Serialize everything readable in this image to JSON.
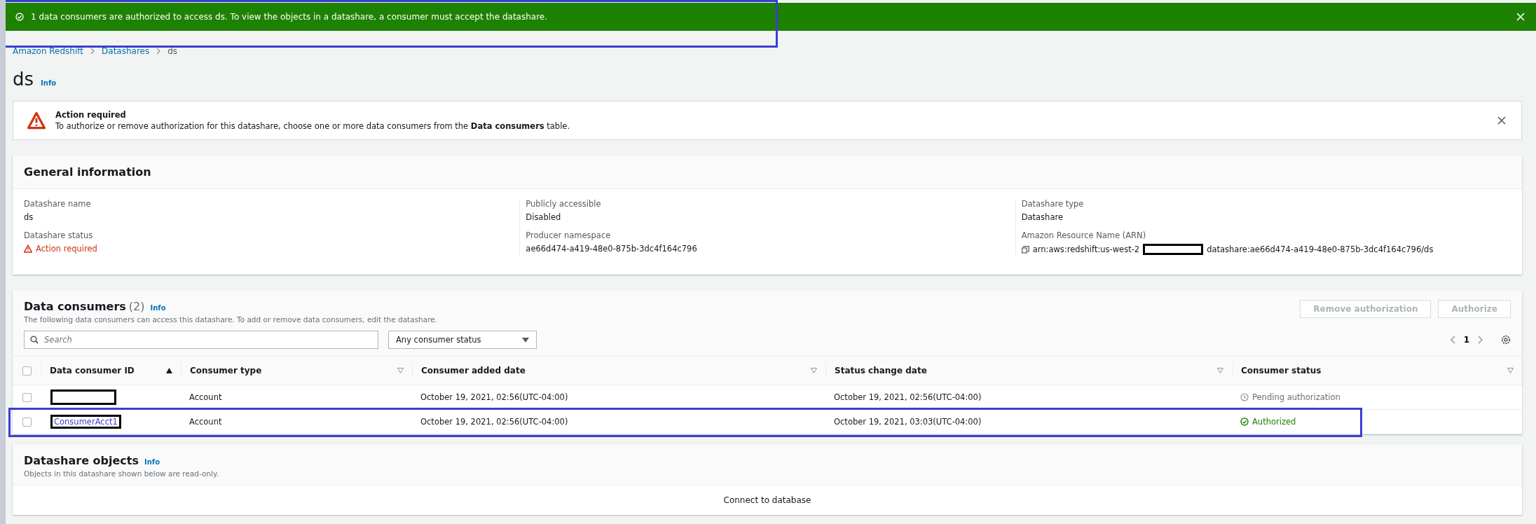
{
  "flash": {
    "message": "1 data consumers are authorized to access ds. To view the objects in a datashare, a consumer must accept the datashare.",
    "highlight": true
  },
  "breadcrumbs": [
    "Amazon Redshift",
    "Datashares",
    "ds"
  ],
  "page": {
    "title": "ds",
    "info": "Info"
  },
  "alert": {
    "title": "Action required",
    "text": "To authorize or remove authorization for this datashare, choose one or more data consumers from the **Data consumers** table."
  },
  "general": {
    "title": "General information",
    "columns": [
      [
        {
          "label": "Datashare name",
          "value": "ds",
          "kind": "text"
        },
        {
          "label": "Datashare status",
          "value": "Action required",
          "kind": "warning"
        }
      ],
      [
        {
          "label": "Publicly accessible",
          "value": "Disabled",
          "kind": "text"
        },
        {
          "label": "Producer namespace",
          "value": "ae66d474-a419-48e0-875b-3dc4f164c796",
          "kind": "text"
        }
      ],
      [
        {
          "label": "Datashare type",
          "value": "Datashare",
          "kind": "text"
        },
        {
          "label": "Amazon Resource Name (ARN)",
          "value": "arn:aws:redshift:us-west-2",
          "value_after": "datashare:ae66d474-a419-48e0-875b-3dc4f164c796/ds",
          "kind": "arn"
        }
      ]
    ]
  },
  "consumers": {
    "title": "Data consumers",
    "count": "(2)",
    "info": "Info",
    "description": "The following data consumers can access this datashare. To add or remove data consumers, edit the datashare.",
    "buttons": [
      {
        "label": "Remove authorization",
        "disabled": true
      },
      {
        "label": "Authorize",
        "disabled": true
      }
    ],
    "search": {
      "placeholder": "Search"
    },
    "filter": "Any consumer status",
    "page": "1",
    "all_checked": false,
    "columns": [
      {
        "label": "Data consumer ID",
        "sorted": true
      },
      {
        "label": "Consumer type",
        "sorted": false
      },
      {
        "label": "Consumer added date",
        "sorted": false
      },
      {
        "label": "Status change date",
        "sorted": false
      },
      {
        "label": "Consumer status",
        "sorted": false
      }
    ],
    "rows": [
      {
        "checked": false,
        "highlight": false,
        "id": null,
        "type": "Account",
        "added": "October 19, 2021, 02:56(UTC-04:00)",
        "changed": "October 19, 2021, 02:56(UTC-04:00)",
        "status": "Pending authorization",
        "kind": "pending"
      },
      {
        "checked": false,
        "highlight": true,
        "id": "ConsumerAcct1",
        "type": "Account",
        "added": "October 19, 2021, 02:56(UTC-04:00)",
        "changed": "October 19, 2021, 03:03(UTC-04:00)",
        "status": "Authorized",
        "kind": "authorized"
      }
    ]
  },
  "objects": {
    "title": "Datashare objects",
    "info": "Info",
    "description": "Objects in this datashare shown below are read-only.",
    "empty": "Connect to database"
  }
}
